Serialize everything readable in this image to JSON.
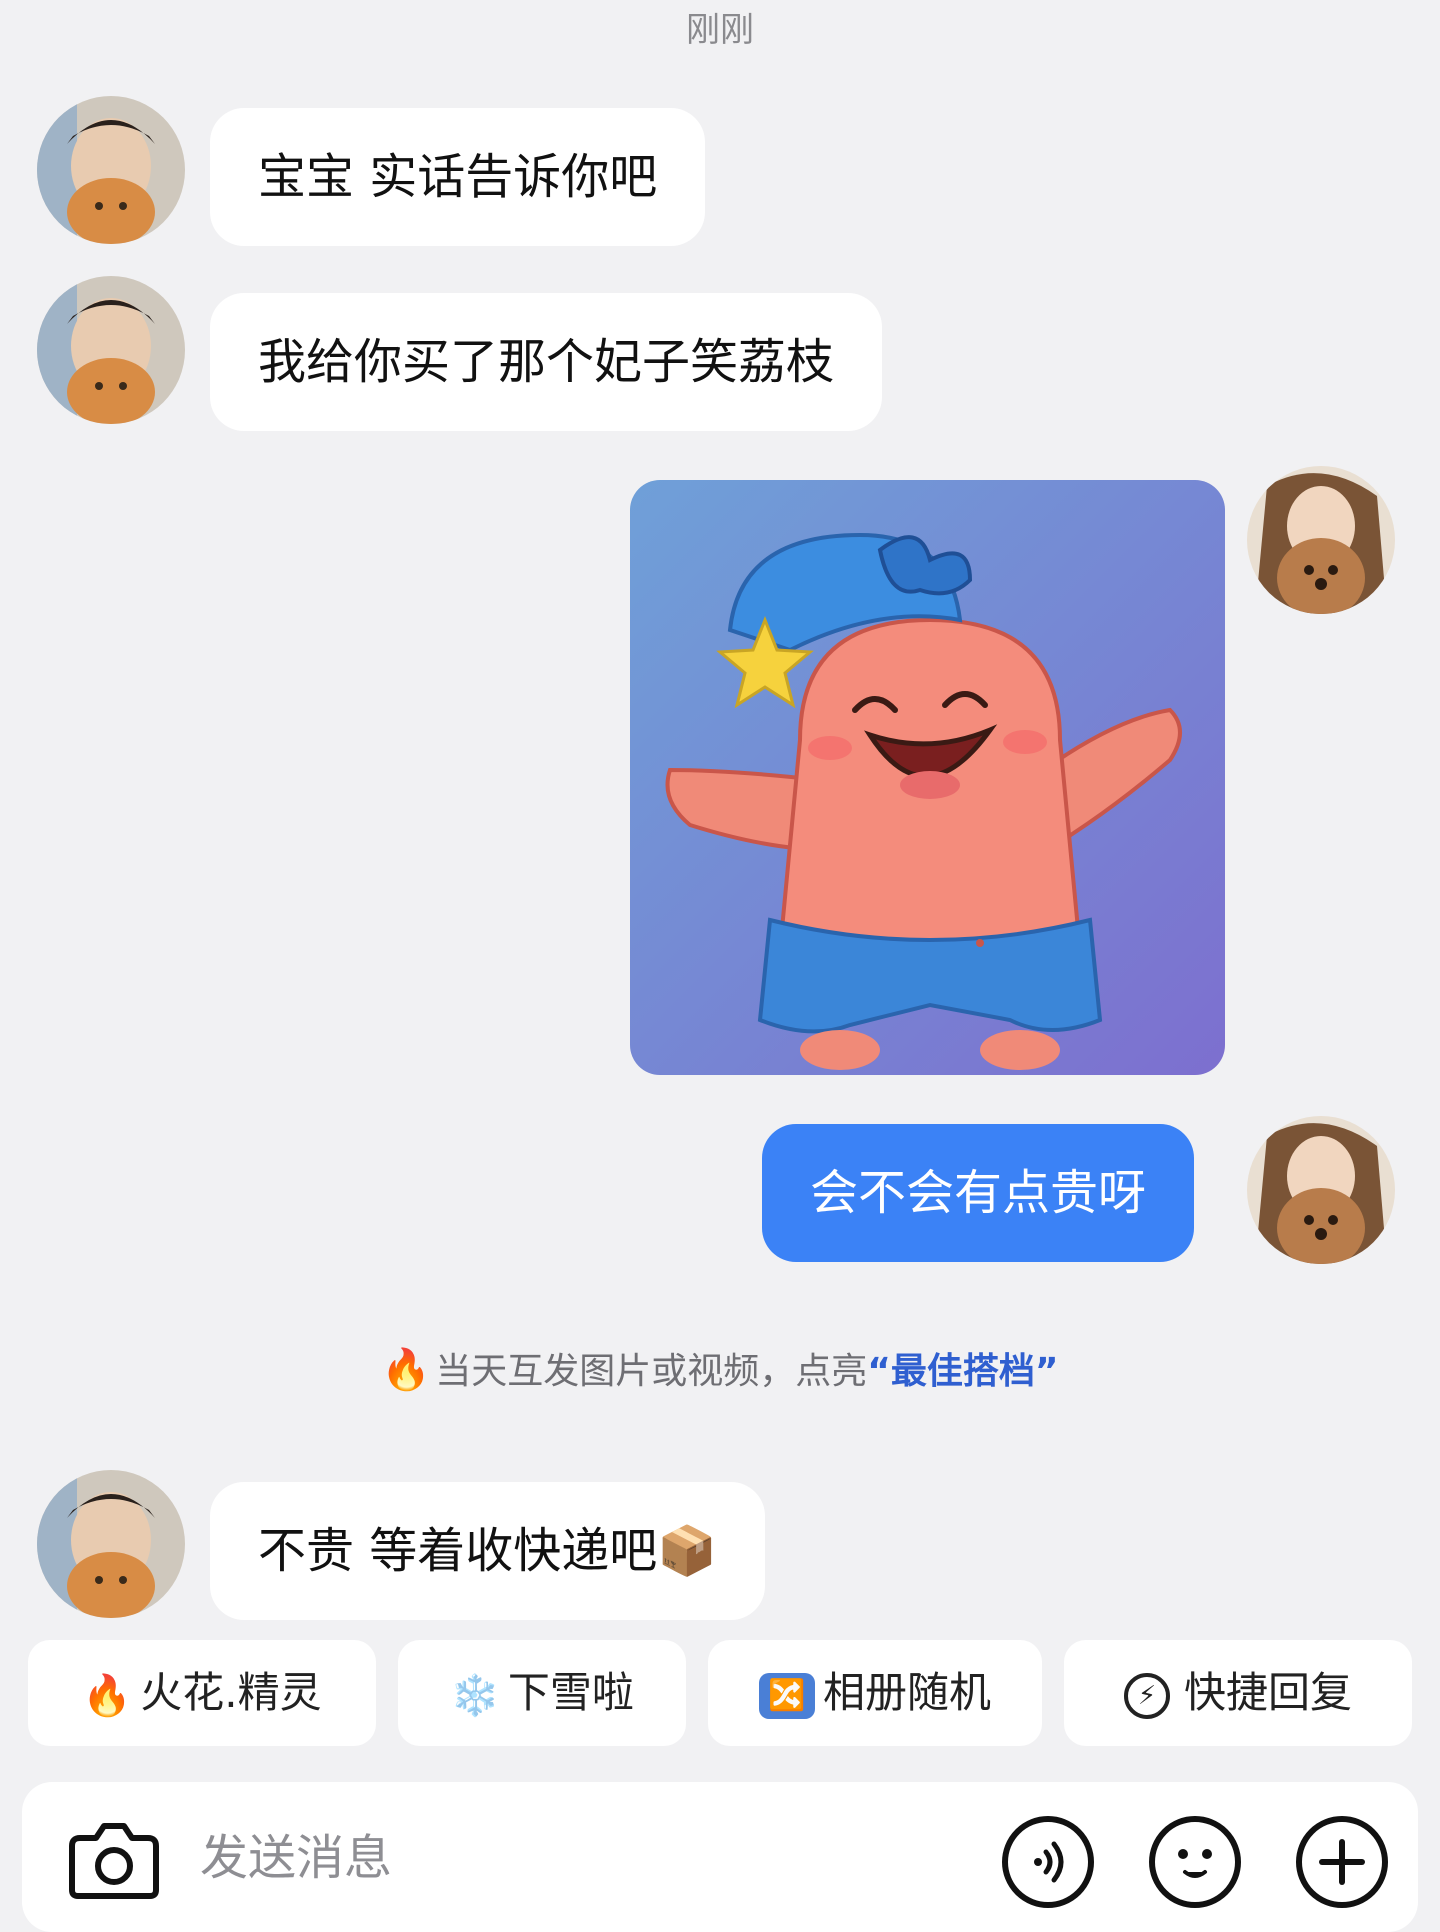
{
  "header": {
    "timestamp": "刚刚"
  },
  "messages": [
    {
      "side": "in",
      "text": "宝宝 实话告诉你吧"
    },
    {
      "side": "in",
      "text": "我给你买了那个妃子笑荔枝"
    },
    {
      "side": "out",
      "type": "image",
      "description": "patrick-star-sticker"
    },
    {
      "side": "out",
      "text": "会不会有点贵呀"
    },
    {
      "side": "in",
      "text": "不贵 等着收快递吧📦"
    }
  ],
  "system_note": {
    "icon": "🔥",
    "text": "当天互发图片或视频，点亮",
    "link": "“最佳搭档”"
  },
  "quick_replies": [
    {
      "icon": "🔥",
      "label": "火花.精灵"
    },
    {
      "icon": "❄️",
      "label": "下雪啦"
    },
    {
      "icon": "🔀",
      "label": "相册随机"
    },
    {
      "icon": "⚡",
      "label": "快捷回复"
    }
  ],
  "composer": {
    "placeholder": "发送消息",
    "value": ""
  },
  "colors": {
    "background": "#f1f1f3",
    "outgoing_bubble": "#3b82f6",
    "incoming_bubble": "#ffffff",
    "link": "#2f5fd0"
  }
}
